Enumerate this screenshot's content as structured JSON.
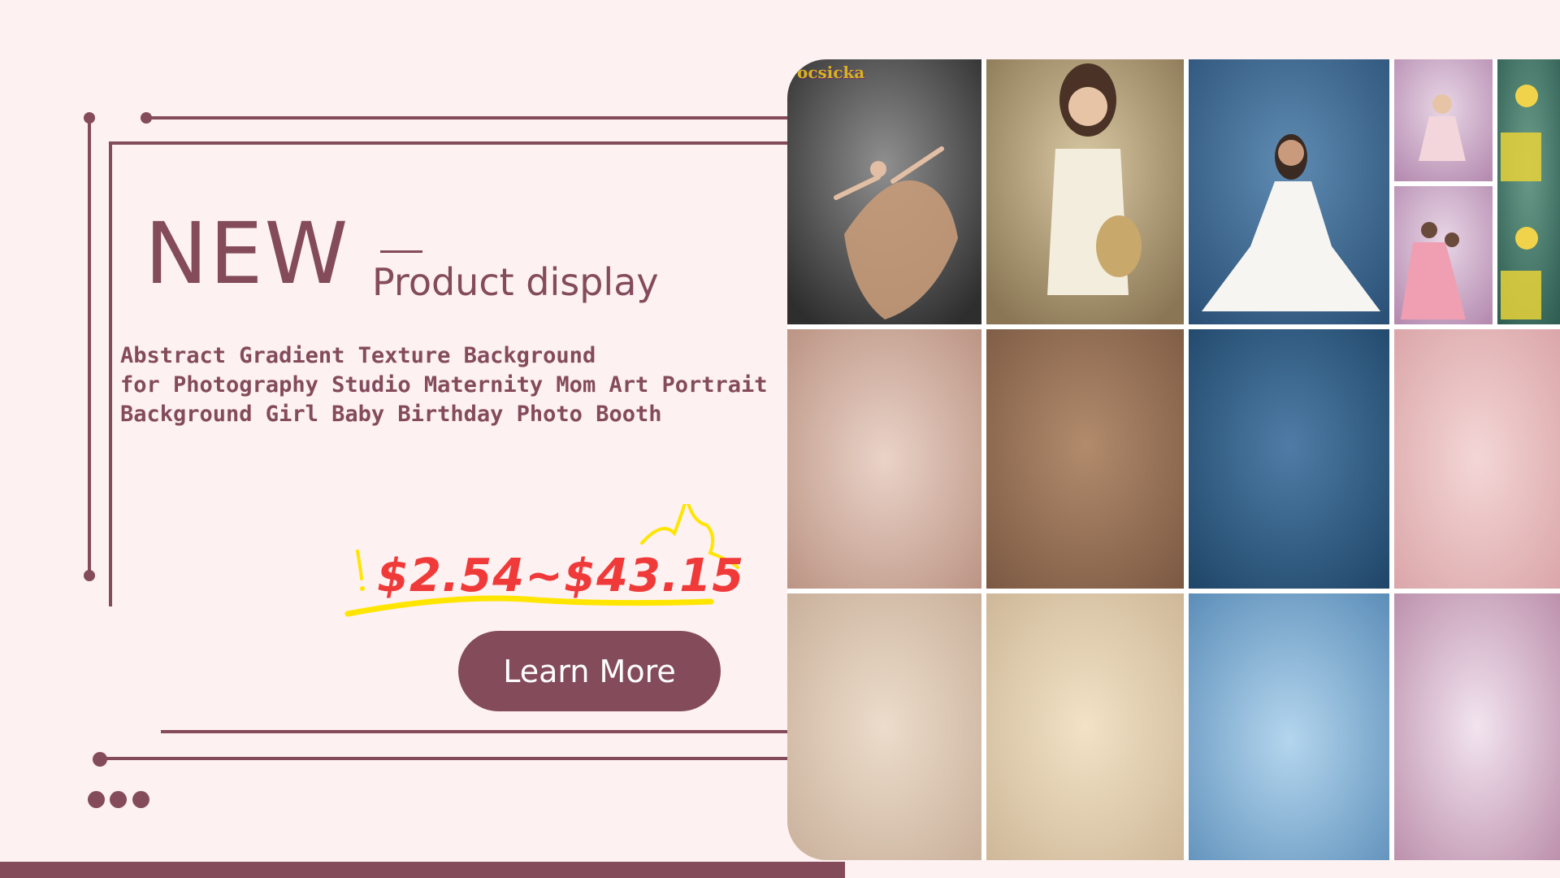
{
  "colors": {
    "background": "#fdf1f1",
    "accent": "#844b5b",
    "price": "#f03a3a",
    "price_highlight": "#ffe500",
    "button_text": "#ffffff"
  },
  "title": {
    "main": "NEW",
    "sub": "Product display"
  },
  "description": "Abstract Gradient Texture Background\nfor Photography Studio Maternity Mom Art Portrait\nBackground Girl Baby Birthday Photo Booth",
  "price": "$2.54~$43.15",
  "learn_more": "Learn More",
  "gallery": {
    "watermark": "ocsicka",
    "row1": [
      "dancer-portrait",
      "girl-with-hat-portrait",
      "woman-white-dress-portrait",
      "toddler-pink-dress-portrait",
      "mother-daughters-portrait",
      "child-yellow-tulips-portrait"
    ],
    "row2": [
      "pink-beige-texture",
      "brown-texture",
      "blue-texture",
      "pink-texture"
    ],
    "row3": [
      "cream-texture",
      "light-beige-texture",
      "light-blue-texture",
      "mauve-texture"
    ]
  }
}
